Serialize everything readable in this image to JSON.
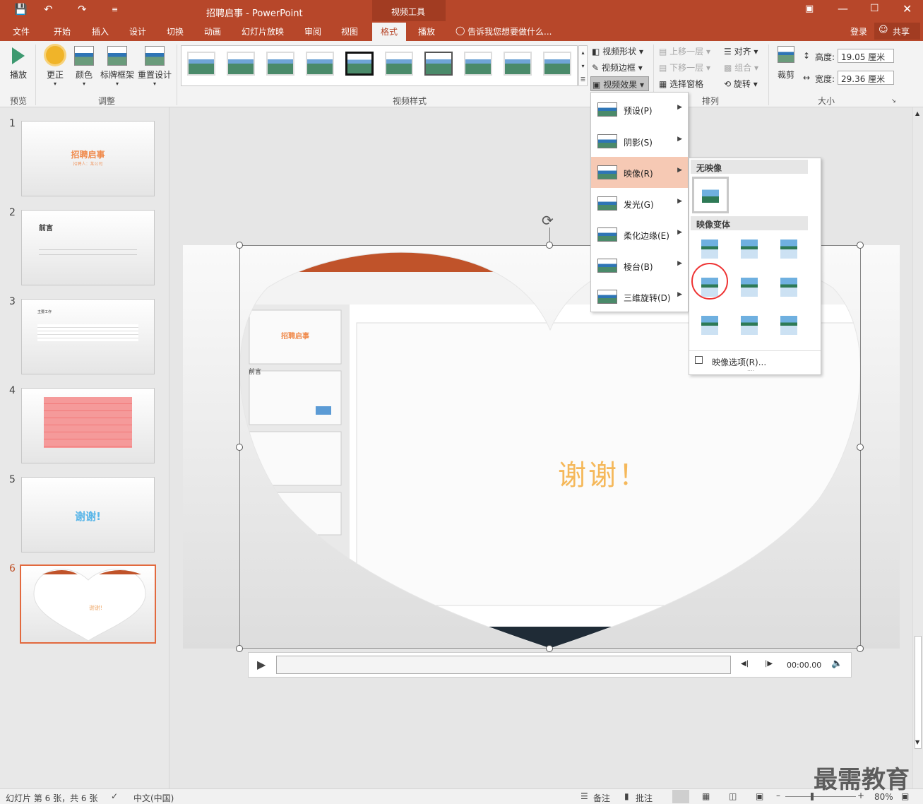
{
  "titlebar": {
    "title": "招聘启事 - PowerPoint",
    "context_tab": "视频工具"
  },
  "tabs": [
    "文件",
    "开始",
    "插入",
    "设计",
    "切换",
    "动画",
    "幻灯片放映",
    "审阅",
    "视图",
    "格式",
    "播放"
  ],
  "tell_me": "告诉我您想要做什么...",
  "login": "登录",
  "share": "共享",
  "ribbon": {
    "play": "播放",
    "preview_group": "预览",
    "adjust": [
      "更正",
      "颜色",
      "标牌框架",
      "重置设计"
    ],
    "adjust_group": "调整",
    "video_styles_group": "视频样式",
    "style_buttons": [
      "视频形状",
      "视频边框",
      "视频效果"
    ],
    "arrange": [
      "上移一层",
      "下移一层",
      "选择窗格",
      "对齐",
      "组合",
      "旋转"
    ],
    "arrange_group": "排列",
    "crop": "裁剪",
    "height_label": "高度:",
    "height_value": "19.05 厘米",
    "width_label": "宽度:",
    "width_value": "29.36 厘米",
    "size_group": "大小"
  },
  "effects_menu": {
    "items": [
      "预设(P)",
      "阴影(S)",
      "映像(R)",
      "发光(G)",
      "柔化边缘(E)",
      "棱台(B)",
      "三维旋转(D)"
    ],
    "highlighted": "映像(R)"
  },
  "reflection_submenu": {
    "no_reflection": "无映像",
    "variants": "映像变体",
    "options": "映像选项(R)..."
  },
  "slides": [
    {
      "num": "1",
      "title": "招聘启事",
      "sub": "招聘人：某公司"
    },
    {
      "num": "2",
      "title": "前言"
    },
    {
      "num": "3",
      "title": "主要工作"
    },
    {
      "num": "4",
      "title": ""
    },
    {
      "num": "5",
      "title": "谢谢!"
    },
    {
      "num": "6",
      "title": "谢谢!"
    }
  ],
  "slide_text": "谢谢！",
  "player": {
    "time": "00:00.00"
  },
  "status": {
    "slide_info": "幻灯片 第 6 张，共 6 张",
    "lang": "中文(中国)",
    "notes": "备注",
    "comments": "批注",
    "zoom": "80%"
  },
  "watermark": "最需教育",
  "colors": {
    "accent": "#b7472a",
    "highlight": "#f6c9b4"
  }
}
